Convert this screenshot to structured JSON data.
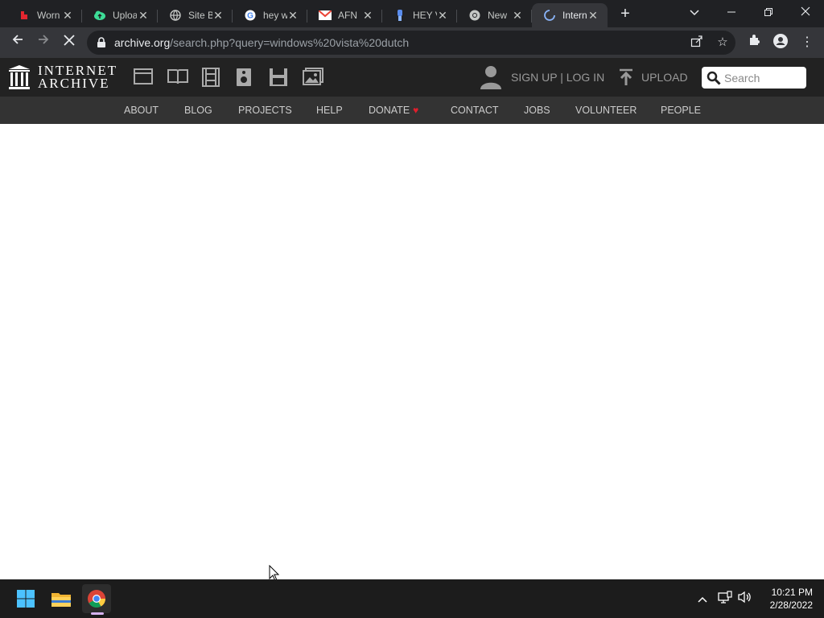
{
  "browser": {
    "tabs": [
      {
        "title": "Worn",
        "icon": "youtube-red-icon"
      },
      {
        "title": "Uploa",
        "icon": "cloud-upload-icon"
      },
      {
        "title": "Site B",
        "icon": "globe-icon"
      },
      {
        "title": "hey w",
        "icon": "google-icon"
      },
      {
        "title": "AFN",
        "icon": "gmail-icon"
      },
      {
        "title": "HEY V",
        "icon": "bot-icon"
      },
      {
        "title": "New",
        "icon": "chrome-icon"
      },
      {
        "title": "Intern",
        "icon": "loading-spinner-icon",
        "active": true
      }
    ],
    "address": {
      "host": "archive.org",
      "path": "/search.php?query=windows%20vista%20dutch"
    }
  },
  "archive": {
    "logo_line1": "INTERNET",
    "logo_line2": "ARCHIVE",
    "signin": "SIGN UP | LOG IN",
    "upload": "UPLOAD",
    "search_placeholder": "Search",
    "nav": [
      "ABOUT",
      "BLOG",
      "PROJECTS",
      "HELP",
      "DONATE",
      "CONTACT",
      "JOBS",
      "VOLUNTEER",
      "PEOPLE"
    ],
    "donate_heart": "♥"
  },
  "taskbar": {
    "time": "10:21 PM",
    "date": "2/28/2022"
  },
  "colors": {
    "tabstrip": "#202124",
    "toolbar": "#35363a",
    "header": "#222222",
    "nav": "#333333",
    "heart": "#e01e2c"
  }
}
